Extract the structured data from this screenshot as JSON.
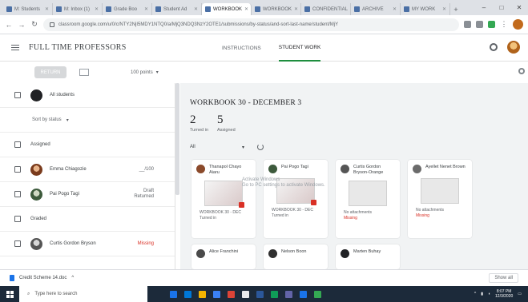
{
  "browser": {
    "tabs": [
      {
        "label": "M: Students"
      },
      {
        "label": "M: Inbox (1)"
      },
      {
        "label": "Grade Boo"
      },
      {
        "label": "Student Ad"
      },
      {
        "label": "WORKBOOK",
        "active": true
      },
      {
        "label": "WORKBOOK"
      },
      {
        "label": "CONFIDENTIAL"
      },
      {
        "label": "ARCHIVE"
      },
      {
        "label": "MY WORK"
      }
    ],
    "new_tab": "+",
    "url": "classroom.google.com/u/0/c/NTY2NjI5MDY1NTQ0/a/MjQ3NDQ3NzY2OTE1/submissions/by-status/and-sort-last-name/student/MjY",
    "window_controls": [
      "–",
      "□",
      "✕"
    ]
  },
  "app": {
    "title": "FULL TIME PROFESSORS",
    "tabs": [
      {
        "label": "INSTRUCTIONS",
        "active": false
      },
      {
        "label": "STUDENT WORK",
        "active": true
      }
    ]
  },
  "toolbar": {
    "return_label": "RETURN",
    "points_label": "100 points",
    "points_chevron": "▾"
  },
  "students": {
    "all_label": "All students",
    "sort_label": "Sort by status",
    "sort_chevron": "▾",
    "group_assigned": "Assigned",
    "group_graded": "Graded",
    "rows": [
      {
        "name": "Emma Chiagozie",
        "grade": "__/100",
        "missing": false
      },
      {
        "name": "Pai Pogo Tagi",
        "grade": "Draft",
        "grade2": "Returned",
        "missing": false
      },
      {
        "name": "Curtis Gordon Bryson",
        "grade": "Missing",
        "missing": true
      }
    ]
  },
  "assignment": {
    "title": "WORKBOOK 30 - DECEMBER 3",
    "turned_in_count": "2",
    "turned_in_label": "Turned in",
    "assigned_count": "5",
    "assigned_label": "Assigned",
    "filter_label": "All",
    "filter_chevron": "▾"
  },
  "cards": [
    {
      "name": "Thanapol Chayo Aiaru",
      "footer": "WORKBOOK 30 - DEC",
      "footer2": "Turned in"
    },
    {
      "name": "Pai Pogo Tagi",
      "footer": "WORKBOOK 30 - DEC",
      "footer2": "Turned in"
    },
    {
      "name": "Curtis Gordon Bryson-Orange",
      "footer": "No attachments",
      "footer2": "Missing"
    },
    {
      "name": "Ayellet Nenet Brown",
      "footer": "No attachments",
      "footer2": "Missing"
    },
    {
      "name": "Alice Franchini"
    },
    {
      "name": "Nelson Boon"
    },
    {
      "name": "Marten Buhay"
    }
  ],
  "watermark": {
    "line1": "Activate Windows",
    "line2": "Go to PC settings to activate Windows."
  },
  "download": {
    "file": "Credit Scheme 14.doc",
    "chevron": "^",
    "show_all": "Show all"
  },
  "taskbar": {
    "search_placeholder": "Type here to search",
    "time": "8:07 PM",
    "date": "12/3/2020"
  },
  "colors": {
    "accent_green": "#1e8e3e",
    "missing_red": "#d93025",
    "taskbar": "#1c2a3a"
  }
}
